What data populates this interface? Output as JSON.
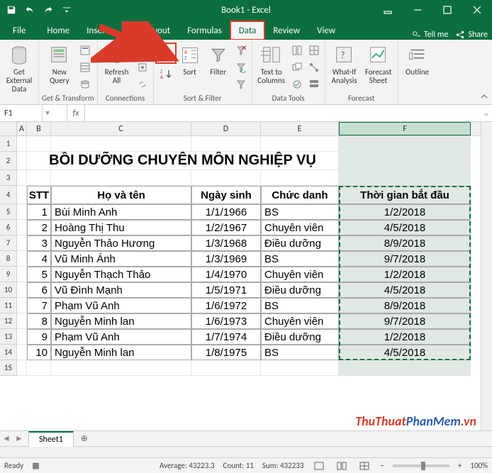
{
  "title": "Book1 - Excel",
  "tabs": [
    "File",
    "Home",
    "Insert",
    "Page Layout",
    "Formulas",
    "Data",
    "Review",
    "View"
  ],
  "active_tab": "Data",
  "tell_me": "Tell me",
  "share": "Share",
  "ribbon": {
    "get_external": "Get External\nData",
    "new_query": "New\nQuery",
    "get_transform": "Get & Transform",
    "refresh_all": "Refresh\nAll",
    "connections": "Connections",
    "sort": "Sort",
    "filter": "Filter",
    "sort_filter": "Sort & Filter",
    "text_to_columns": "Text to\nColumns",
    "data_tools": "Data Tools",
    "what_if": "What-If\nAnalysis",
    "forecast_sheet": "Forecast\nSheet",
    "forecast": "Forecast",
    "outline": "Outline"
  },
  "name_box": "F1",
  "col_headers": [
    "A",
    "B",
    "C",
    "D",
    "E",
    "F"
  ],
  "row_headers": [
    "1",
    "2",
    "3",
    "4",
    "5",
    "6",
    "7",
    "8",
    "9",
    "10",
    "11",
    "12",
    "13",
    "14",
    "15"
  ],
  "main_title": "BỒI DƯỠNG CHUYÊN MÔN NGHIỆP VỤ",
  "table_headers": {
    "stt": "STT",
    "name": "Họ và tên",
    "dob": "Ngày sinh",
    "pos": "Chức danh",
    "start": "Thời gian bắt đầu"
  },
  "rows": [
    {
      "stt": "1",
      "name": "Bùi Minh Anh",
      "dob": "1/1/1966",
      "pos": "BS",
      "start": "1/2/2018"
    },
    {
      "stt": "2",
      "name": "Hoàng Thị Thu",
      "dob": "1/2/1967",
      "pos": "Chuyên viên",
      "start": "4/5/2018"
    },
    {
      "stt": "3",
      "name": "Nguyễn Thảo Hương",
      "dob": "1/3/1968",
      "pos": "Điều dưỡng",
      "start": "8/9/2018"
    },
    {
      "stt": "4",
      "name": "Vũ Minh Ánh",
      "dob": "1/3/1969",
      "pos": "BS",
      "start": "9/7/2018"
    },
    {
      "stt": "5",
      "name": "Nguyễn Thạch Thảo",
      "dob": "1/4/1970",
      "pos": "Chuyên viên",
      "start": "1/2/2018"
    },
    {
      "stt": "6",
      "name": "Vũ Đình Mạnh",
      "dob": "1/5/1971",
      "pos": "Điều dưỡng",
      "start": "4/5/2018"
    },
    {
      "stt": "7",
      "name": "Phạm Vũ Anh",
      "dob": "1/6/1972",
      "pos": "BS",
      "start": "8/9/2018"
    },
    {
      "stt": "8",
      "name": "Nguyễn Minh lan",
      "dob": "1/6/1973",
      "pos": "Chuyên viên",
      "start": "9/7/2018"
    },
    {
      "stt": "9",
      "name": "Phạm Vũ Anh",
      "dob": "1/7/1974",
      "pos": "Điều dưỡng",
      "start": "1/2/2018"
    },
    {
      "stt": "10",
      "name": "Nguyễn Minh lan",
      "dob": "1/8/1975",
      "pos": "BS",
      "start": "4/5/2018"
    }
  ],
  "sheet_tab": "Sheet1",
  "status": {
    "ready": "Ready",
    "average": "Average: 43223.3",
    "count": "Count: 11",
    "sum": "Sum: 432233",
    "zoom": "100%"
  },
  "watermark1": "ThuThuat",
  "watermark2": "PhanMem",
  "watermark3": ".vn"
}
